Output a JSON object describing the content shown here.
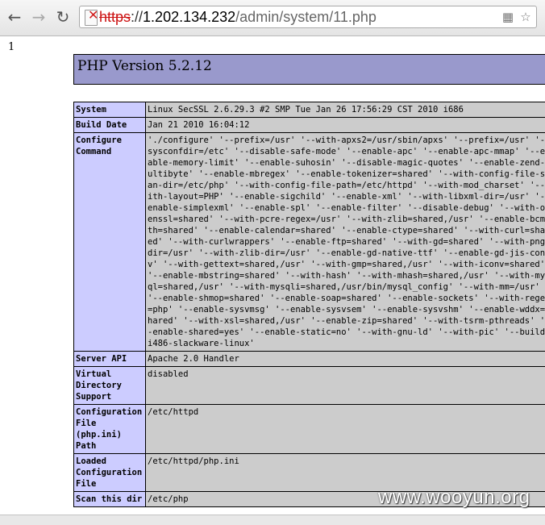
{
  "browser": {
    "back_icon": "back-arrow-icon",
    "forward_icon": "forward-arrow-icon",
    "reload_icon": "reload-icon",
    "url_scheme": "https",
    "url_sep": "://",
    "url_host": "1.202.134.232",
    "url_path": "/admin/system/11.php",
    "page_action_icon": "page-icon",
    "bookmark_icon": "star-icon"
  },
  "page": {
    "output_text": "1",
    "php_version": "PHP Version 5.2.12",
    "rows": [
      {
        "key": "System",
        "value": "Linux SecSSL 2.6.29.3 #2 SMP Tue Jan 26 17:56:29 CST 2010 i686"
      },
      {
        "key": "Build Date",
        "value": "Jan 21 2010 16:04:12"
      },
      {
        "key": "Configure Command",
        "value": "'./configure' '--prefix=/usr' '--with-apxs2=/usr/sbin/apxs' '--prefix=/usr' '--sysconfdir=/etc' '--disable-safe-mode' '--enable-apc' '--enable-apc-mmap' '--enable-memory-limit' '--enable-suhosin' '--disable-magic-quotes' '--enable-zend-multibyte' '--enable-mbregex' '--enable-tokenizer=shared' '--with-config-file-scan-dir=/etc/php' '--with-config-file-path=/etc/httpd' '--with-mod_charset' '--with-layout=PHP' '--enable-sigchild' '--enable-xml' '--with-libxml-dir=/usr' '--enable-simplexml' '--enable-spl' '--enable-filter' '--disable-debug' '--with-openssl=shared' '--with-pcre-regex=/usr' '--with-zlib=shared,/usr' '--enable-bcmath=shared' '--enable-calendar=shared' '--enable-ctype=shared' '--with-curl=shared' '--with-curlwrappers' '--enable-ftp=shared' '--with-gd=shared' '--with-png-dir=/usr' '--with-zlib-dir=/usr' '--enable-gd-native-ttf' '--enable-gd-jis-conv' '--with-gettext=shared,/usr' '--with-gmp=shared,/usr' '--with-iconv=shared' '--enable-mbstring=shared' '--with-hash' '--with-mhash=shared,/usr' '--with-mysql=shared,/usr' '--with-mysqli=shared,/usr/bin/mysql_config' '--with-mm=/usr' '--enable-shmop=shared' '--enable-soap=shared' '--enable-sockets' '--with-regex=php' '--enable-sysvmsg' '--enable-sysvsem' '--enable-sysvshm' '--enable-wddx=shared' '--with-xsl=shared,/usr' '--enable-zip=shared' '--with-tsrm-pthreads' '--enable-shared=yes' '--enable-static=no' '--with-gnu-ld' '--with-pic' '--build=i486-slackware-linux'"
      },
      {
        "key": "Server API",
        "value": "Apache 2.0 Handler"
      },
      {
        "key": "Virtual Directory Support",
        "value": "disabled"
      },
      {
        "key": "Configuration File (php.ini) Path",
        "value": "/etc/httpd"
      },
      {
        "key": "Loaded Configuration File",
        "value": "/etc/httpd/php.ini"
      },
      {
        "key": "Scan this dir",
        "value": "/etc/php"
      }
    ],
    "watermark": "www.wooyun.org"
  },
  "colors": {
    "header_bg": "#9999cc",
    "key_bg": "#ccccff",
    "value_bg": "#cccccc",
    "insecure_red": "#cc1111"
  }
}
